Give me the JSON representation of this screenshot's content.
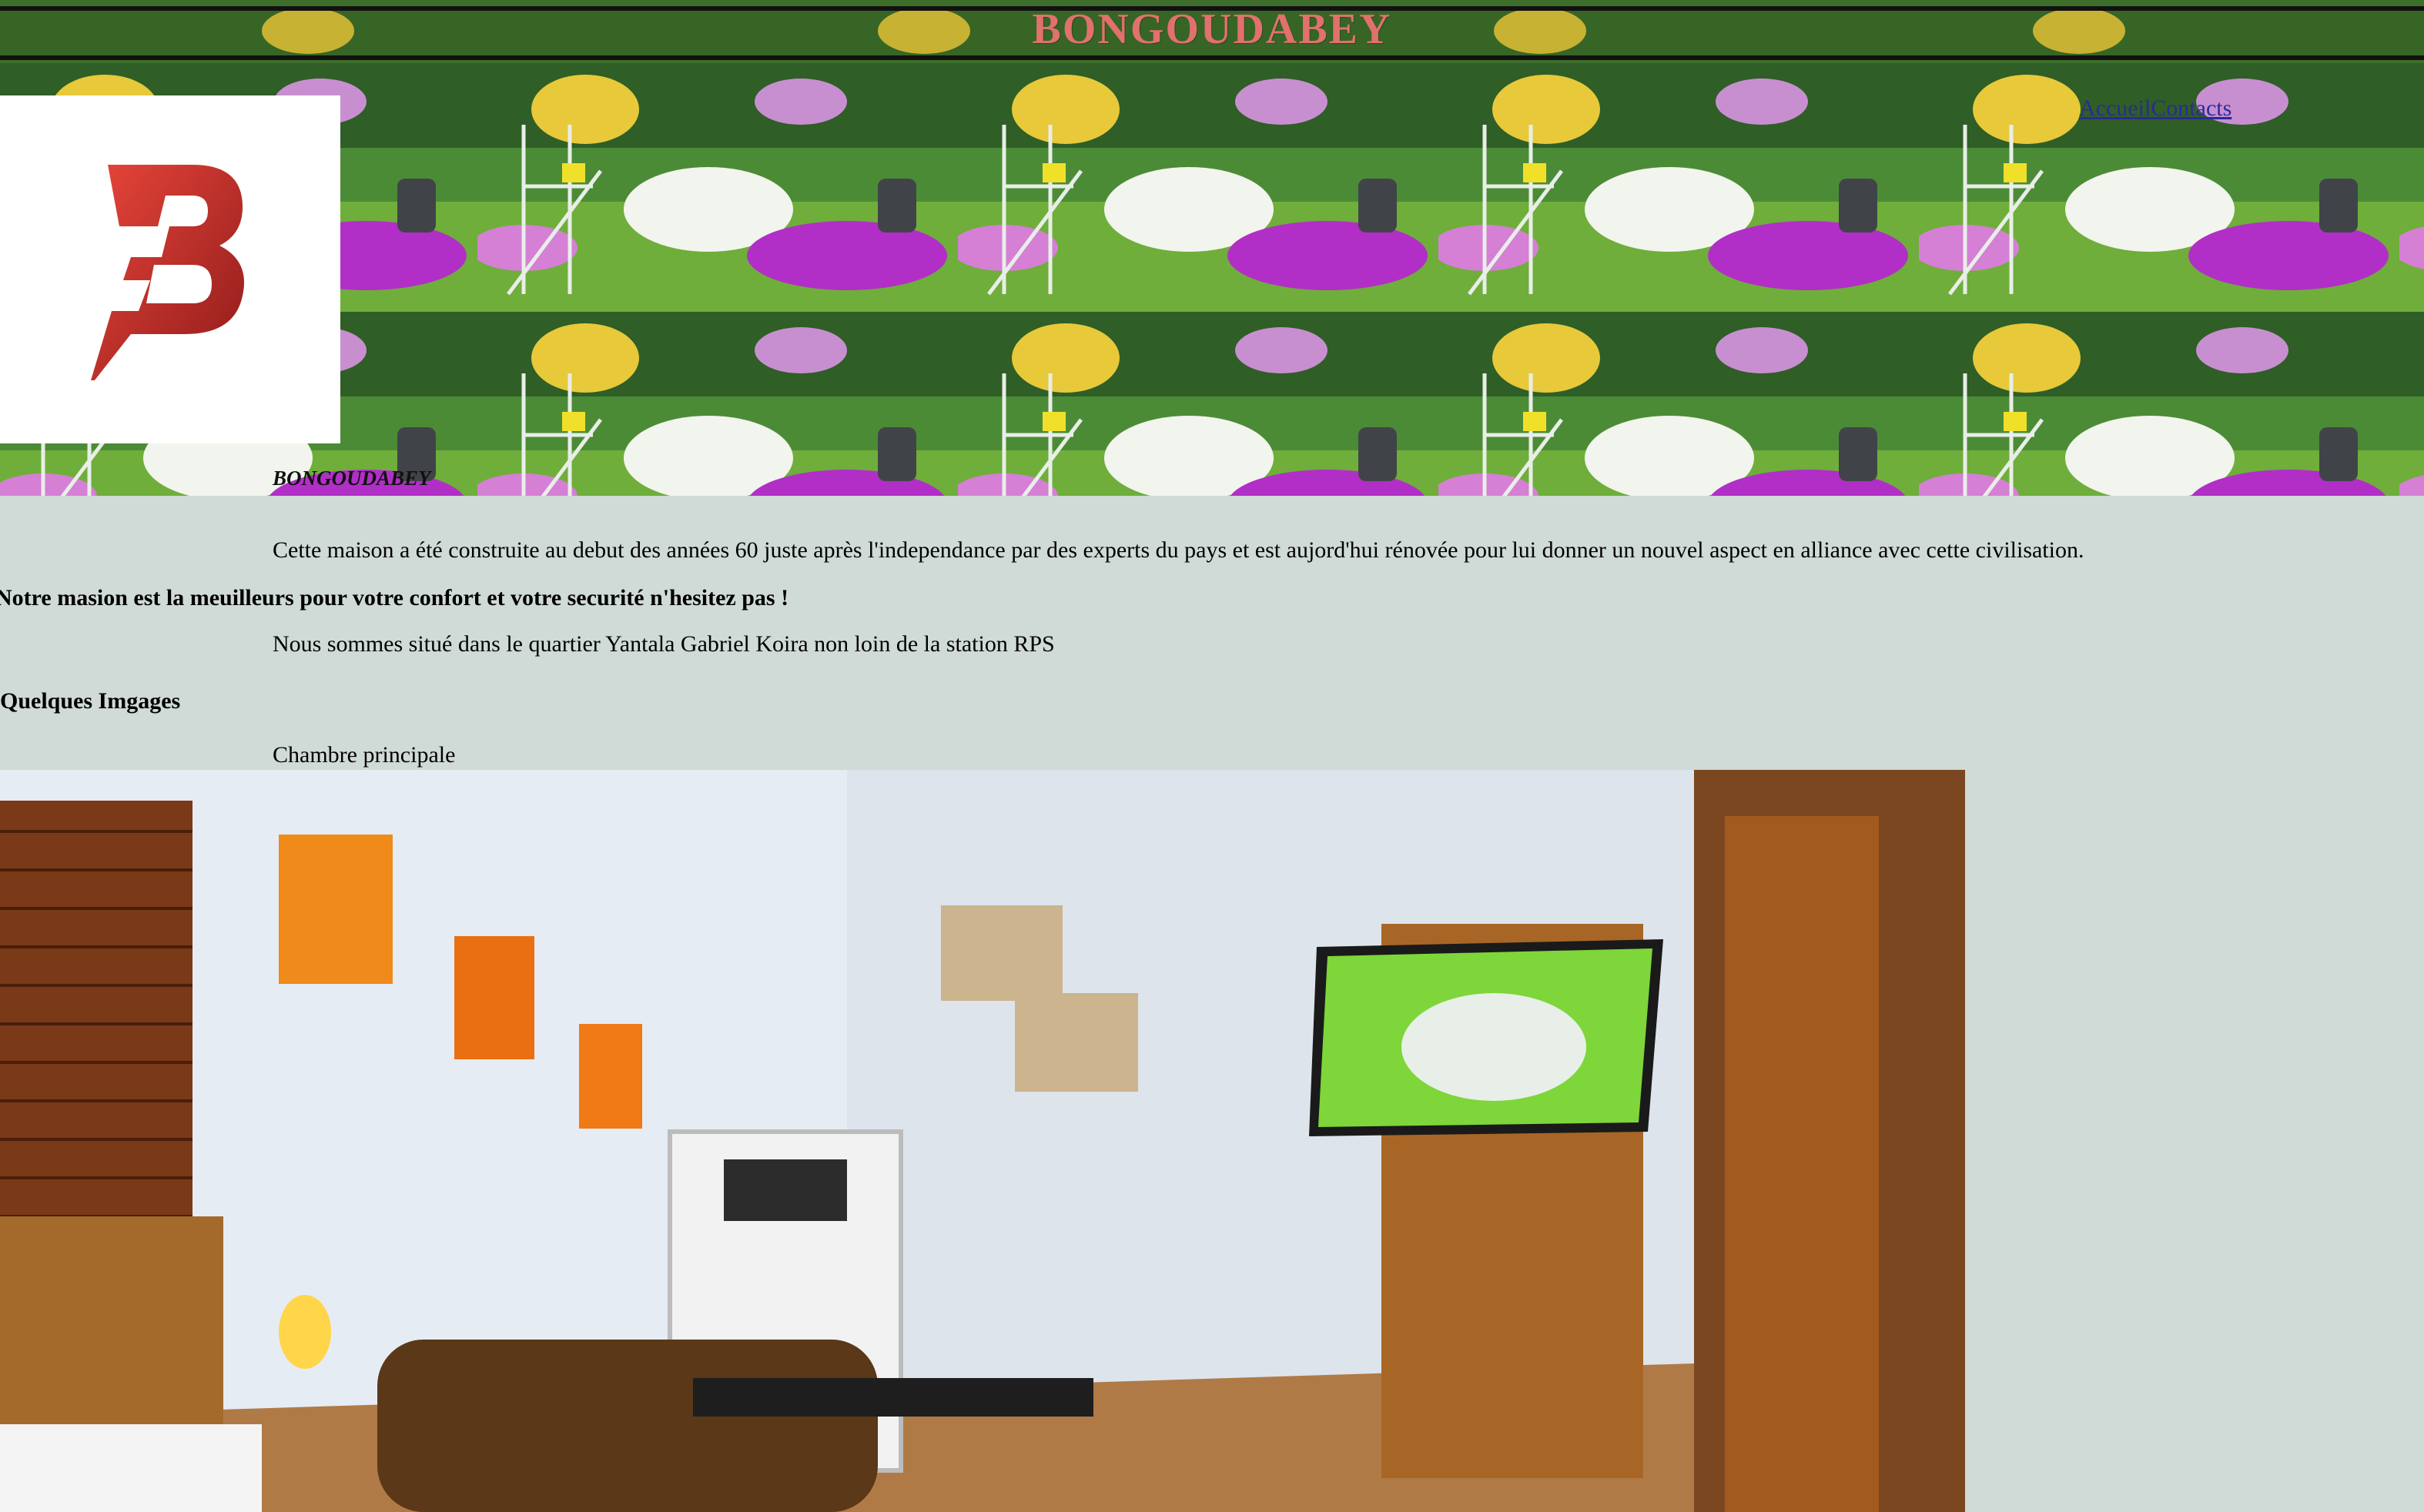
{
  "header": {
    "site_title": "BONGOUDABEY",
    "caption": "BONGOUDABEY"
  },
  "nav": {
    "home_label": "Accueil",
    "contacts_label": "Contacts"
  },
  "content": {
    "intro": "Cette maison a été construite au debut des années 60 juste après l'independance par des experts du pays et est aujord'hui rénovée pour lui donner un nouvel aspect en alliance avec cette civilisation.",
    "tagline": "Notre masion est la meuilleurs pour votre confort et votre securité n'hesitez pas !",
    "location": "Nous sommes situé dans le quartier Yantala Gabriel Koira non loin de la station RPS",
    "gallery_heading": "Quelques Imgages",
    "photo_caption": "Chambre principale"
  },
  "icons": {
    "logo": "brand-b-lightning-logo"
  },
  "colors": {
    "page_background": "#d0dad6",
    "title_color": "#e0716c",
    "logo_red": "#c62828"
  }
}
